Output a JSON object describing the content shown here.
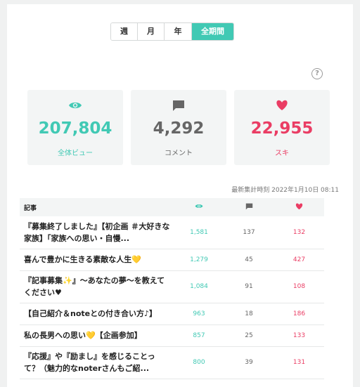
{
  "tabs": [
    {
      "label": "週"
    },
    {
      "label": "月"
    },
    {
      "label": "年"
    },
    {
      "label": "全期間"
    }
  ],
  "help_icon": "?",
  "stats": [
    {
      "icon": "eye-icon",
      "value": "207,804",
      "label": "全体ビュー",
      "color": "#41c9b4"
    },
    {
      "icon": "comment-icon",
      "value": "4,292",
      "label": "コメント",
      "color": "#666666"
    },
    {
      "icon": "heart-icon",
      "value": "22,955",
      "label": "スキ",
      "color": "#ea3d64"
    }
  ],
  "timestamp": "最新集計時刻 2022年1月10日 08:11",
  "table": {
    "header": {
      "article": "記事"
    },
    "rows": [
      {
        "title": "『募集終了しました』【初企画 ＃大好きな家族】「家族への思い・自慢...",
        "views": "1,581",
        "comments": "137",
        "likes": "132"
      },
      {
        "title": "喜んで豊かに生きる素敵な人生💛",
        "views": "1,279",
        "comments": "45",
        "likes": "427"
      },
      {
        "title": "『記事募集✨』～あなたの夢～を教えてください♥",
        "views": "1,084",
        "comments": "91",
        "likes": "108"
      },
      {
        "title": "【自己紹介＆noteとの付き合い方♪】",
        "views": "963",
        "comments": "18",
        "likes": "186"
      },
      {
        "title": "私の長男への思い💛【企画参加】",
        "views": "857",
        "comments": "25",
        "likes": "133"
      },
      {
        "title": "『応援』や『励まし』を感じることって？（魅力的なnoterさんもご紹...",
        "views": "800",
        "comments": "39",
        "likes": "131"
      }
    ]
  }
}
